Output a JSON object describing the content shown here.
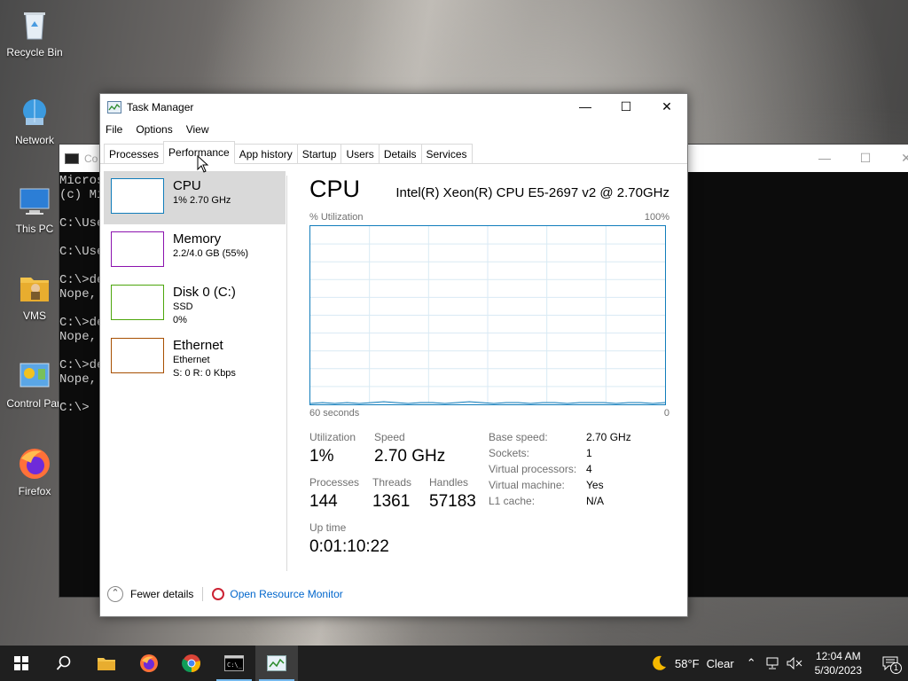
{
  "desktop": {
    "icons": [
      {
        "label": "Recycle Bin",
        "icon": "recycle-bin-icon"
      },
      {
        "label": "Network",
        "icon": "network-icon"
      },
      {
        "label": "This PC",
        "icon": "this-pc-icon"
      },
      {
        "label": "VMS",
        "icon": "folder-icon"
      },
      {
        "label": "Control Pan",
        "icon": "control-panel-icon"
      },
      {
        "label": "Firefox",
        "icon": "firefox-icon"
      }
    ]
  },
  "console": {
    "title": "Co",
    "lines": [
      "Micros",
      "(c) Mi",
      "",
      "C:\\Use",
      "",
      "C:\\Use",
      "",
      "C:\\>de",
      "Nope,",
      "",
      "C:\\>de",
      "Nope,",
      "",
      "C:\\>de",
      "Nope,",
      "",
      "C:\\>"
    ]
  },
  "task_manager": {
    "title": "Task Manager",
    "menu": [
      "File",
      "Options",
      "View"
    ],
    "tabs": [
      "Processes",
      "Performance",
      "App history",
      "Startup",
      "Users",
      "Details",
      "Services"
    ],
    "active_tab": "Performance",
    "perf_items": [
      {
        "name": "CPU",
        "sub1": "1% 2.70 GHz",
        "sub2": "",
        "color": "#117dbb",
        "selected": true
      },
      {
        "name": "Memory",
        "sub1": "2.2/4.0 GB (55%)",
        "sub2": "",
        "color": "#8b12ae",
        "selected": false
      },
      {
        "name": "Disk 0 (C:)",
        "sub1": "SSD",
        "sub2": "0%",
        "color": "#4da60c",
        "selected": false
      },
      {
        "name": "Ethernet",
        "sub1": "Ethernet",
        "sub2": "S: 0 R: 0 Kbps",
        "color": "#a74f01",
        "selected": false
      }
    ],
    "detail": {
      "heading": "CPU",
      "model": "Intel(R) Xeon(R) CPU E5-2697 v2 @ 2.70GHz",
      "graph_top_left": "% Utilization",
      "graph_top_right": "100%",
      "graph_bottom_left": "60 seconds",
      "graph_bottom_right": "0",
      "utilization_series_percent": [
        0.5,
        1,
        0.5,
        1,
        0.5,
        1,
        1.5,
        1,
        0.5,
        1,
        1,
        0.5,
        1,
        1.5,
        1,
        0.5,
        1,
        1,
        0.5,
        1,
        1,
        0.5,
        1,
        1,
        1,
        0.5,
        1,
        1,
        0.5,
        1
      ],
      "stats": {
        "utilization_label": "Utilization",
        "utilization": "1%",
        "speed_label": "Speed",
        "speed": "2.70 GHz",
        "processes_label": "Processes",
        "processes": "144",
        "threads_label": "Threads",
        "threads": "1361",
        "handles_label": "Handles",
        "handles": "57183",
        "uptime_label": "Up time",
        "uptime": "0:01:10:22"
      },
      "props": [
        {
          "k": "Base speed:",
          "v": "2.70 GHz"
        },
        {
          "k": "Sockets:",
          "v": "1"
        },
        {
          "k": "Virtual processors:",
          "v": "4"
        },
        {
          "k": "Virtual machine:",
          "v": "Yes"
        },
        {
          "k": "L1 cache:",
          "v": "N/A"
        }
      ]
    },
    "footer": {
      "fewer": "Fewer details",
      "monitor": "Open Resource Monitor"
    }
  },
  "taskbar": {
    "weather_temp": "58°F",
    "weather_text": "Clear",
    "time": "12:04 AM",
    "date": "5/30/2023",
    "notification_count": "1"
  }
}
